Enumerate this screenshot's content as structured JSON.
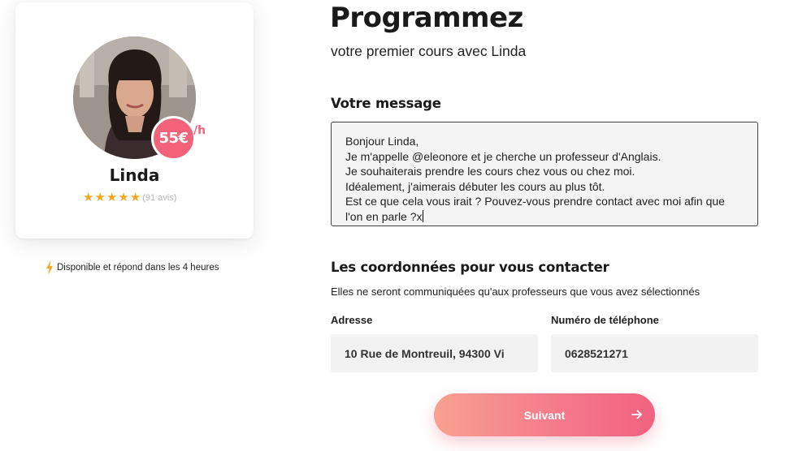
{
  "tutor": {
    "name": "Linda",
    "price": "55€",
    "price_unit": "/h",
    "stars": 5,
    "reviews": "(91 avis)"
  },
  "availability": "Disponible et répond dans les 4 heures",
  "header": {
    "title": "Programmez",
    "subtitle": "votre premier cours avec Linda"
  },
  "message": {
    "title": "Votre message",
    "value": "Bonjour Linda,\nJe m'appelle @eleonore et je cherche un professeur d'Anglais.\nJe souhaiterais prendre les cours chez vous ou chez moi.\nIdéalement, j'aimerais débuter les cours au plus tôt.\nEst ce que cela vous irait ? Pouvez-vous prendre contact avec moi afin que\nl'on en parle ?x"
  },
  "contact": {
    "title": "Les coordonnées pour vous contacter",
    "description": "Elles ne seront communiquées qu'aux professeurs que vous avez sélectionnés",
    "address_label": "Adresse",
    "address_value": "10 Rue de Montreuil, 94300 Vi",
    "phone_label": "Numéro de téléphone",
    "phone_value": "0628521271"
  },
  "next_button": {
    "label": "Suivant",
    "icon": "arrow-right-icon"
  },
  "colors": {
    "accent": "#f2637a",
    "star": "#f5a623",
    "button_start": "#f8a091",
    "button_end": "#f26281"
  }
}
